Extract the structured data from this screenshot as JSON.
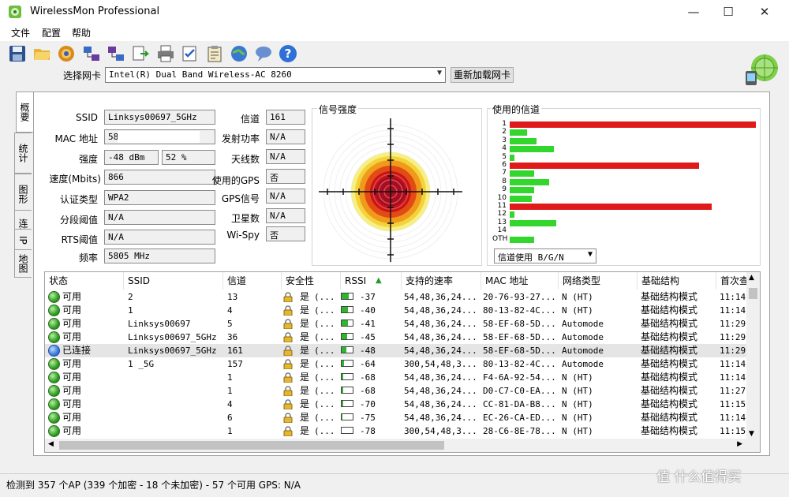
{
  "window": {
    "title": "WirelessMon Professional",
    "minimize": "—",
    "maximize": "☐",
    "close": "✕"
  },
  "menu": [
    "文件",
    "配置",
    "帮助"
  ],
  "toolbar_icons": [
    "save-icon",
    "open-folder-icon",
    "record-icon",
    "network-icon",
    "network-config-icon",
    "export-icon",
    "print-icon",
    "checklist-icon",
    "clipboard-icon",
    "globe-icon",
    "speech-icon",
    "help-icon"
  ],
  "nic": {
    "label": "选择网卡",
    "value": "Intel(R) Dual Band Wireless-AC 8260",
    "reload": "重新加载网卡"
  },
  "side_tabs": [
    "概要",
    "统计",
    "图形",
    "连接",
    "IP",
    "地图"
  ],
  "summary": {
    "ssid_label": "SSID",
    "ssid": "Linksys00697_5GHz",
    "mac_label": "MAC 地址",
    "mac": "58",
    "strength_label": "强度",
    "strength_dbm": "-48 dBm",
    "strength_pct": "52 %",
    "speed_label": "速度(Mbits)",
    "speed": "866",
    "auth_label": "认证类型",
    "auth": "WPA2",
    "frag_label": "分段阈值",
    "frag": "N/A",
    "rts_label": "RTS阈值",
    "rts": "N/A",
    "freq_label": "频率",
    "freq": "5805 MHz",
    "channel_label": "信道",
    "channel": "161",
    "txpower_label": "发射功率",
    "txpower": "N/A",
    "antenna_label": "天线数",
    "antenna": "N/A",
    "gps_use_label": "使用的GPS",
    "gps_use": "否",
    "gps_signal_label": "GPS信号",
    "gps_signal": "N/A",
    "sat_label": "卫星数",
    "sat": "N/A",
    "wispy_label": "Wi-Spy",
    "wispy": "否"
  },
  "signal": {
    "title": "信号强度",
    "colors": [
      "#f6ef88",
      "#f3d23a",
      "#ef9a1c",
      "#e34b14",
      "#c81317",
      "#a30e25"
    ]
  },
  "channels": {
    "title": "使用的信道",
    "labels": [
      "1",
      "2",
      "3",
      "4",
      "5",
      "6",
      "7",
      "8",
      "9",
      "10",
      "11",
      "12",
      "13",
      "14",
      "OTH"
    ],
    "usage": [
      100,
      7,
      11,
      18,
      2,
      77,
      10,
      16,
      10,
      9,
      82,
      2,
      19,
      0,
      10
    ],
    "highlight": [
      0,
      5,
      10
    ],
    "colors": {
      "hi": "#e01a1a",
      "normal": "#33d62c"
    },
    "select": "信道使用 B/G/N"
  },
  "table": {
    "headers": [
      "状态",
      "SSID",
      "信道",
      "安全性",
      "RSSI",
      "支持的速率",
      "MAC 地址",
      "网络类型",
      "基础结构",
      "首次查"
    ],
    "sort_arrow": "▲",
    "rows": [
      {
        "status": "可用",
        "state": "green",
        "ssid": "2",
        "channel": "13",
        "sec_yes": "是",
        "sec": "(...",
        "rssi": "-37",
        "rssi_pct": 62,
        "rates": "54,48,36,24...",
        "mac": "20-76-93-27...",
        "type": "N (HT)",
        "infra": "基础结构模式",
        "first": "11:14:"
      },
      {
        "status": "可用",
        "state": "green",
        "ssid": "1",
        "channel": "4",
        "sec_yes": "是",
        "sec": "(...",
        "rssi": "-40",
        "rssi_pct": 58,
        "rates": "54,48,36,24...",
        "mac": "80-13-82-4C...",
        "type": "N (HT)",
        "infra": "基础结构模式",
        "first": "11:14:"
      },
      {
        "status": "可用",
        "state": "green",
        "ssid": "Linksys00697",
        "channel": "5",
        "sec_yes": "是",
        "sec": "(...",
        "rssi": "-41",
        "rssi_pct": 56,
        "rates": "54,48,36,24...",
        "mac": "58-EF-68-5D...",
        "type": "Automode",
        "infra": "基础结构模式",
        "first": "11:29:"
      },
      {
        "status": "可用",
        "state": "green",
        "ssid": "Linksys00697_5GHz",
        "channel": "36",
        "sec_yes": "是",
        "sec": "(...",
        "rssi": "-45",
        "rssi_pct": 50,
        "rates": "54,48,36,24...",
        "mac": "58-EF-68-5D...",
        "type": "Automode",
        "infra": "基础结构模式",
        "first": "11:29:"
      },
      {
        "status": "已连接",
        "state": "blue",
        "ssid": "Linksys00697_5GHz",
        "channel": "161",
        "sec_yes": "是",
        "sec": "(...",
        "rssi": "-48",
        "rssi_pct": 45,
        "rates": "54,48,36,24...",
        "mac": "58-EF-68-5D...",
        "type": "Automode",
        "infra": "基础结构模式",
        "first": "11:29:"
      },
      {
        "status": "可用",
        "state": "green",
        "ssid": "1         _5G",
        "channel": "157",
        "sec_yes": "是",
        "sec": "(...",
        "rssi": "-64",
        "rssi_pct": 22,
        "rates": "300,54,48,3...",
        "mac": "80-13-82-4C...",
        "type": "Automode",
        "infra": "基础结构模式",
        "first": "11:14:"
      },
      {
        "status": "可用",
        "state": "green",
        "ssid": "",
        "channel": "1",
        "sec_yes": "是",
        "sec": "(...",
        "rssi": "-68",
        "rssi_pct": 15,
        "rates": "54,48,36,24...",
        "mac": "F4-6A-92-54...",
        "type": "N (HT)",
        "infra": "基础结构模式",
        "first": "11:14:"
      },
      {
        "status": "可用",
        "state": "green",
        "ssid": "",
        "channel": "1",
        "sec_yes": "是",
        "sec": "(...",
        "rssi": "-68",
        "rssi_pct": 15,
        "rates": "54,48,36,24...",
        "mac": "D0-C7-C0-EA...",
        "type": "N (HT)",
        "infra": "基础结构模式",
        "first": "11:27:"
      },
      {
        "status": "可用",
        "state": "green",
        "ssid": "",
        "channel": "4",
        "sec_yes": "是",
        "sec": "(...",
        "rssi": "-70",
        "rssi_pct": 12,
        "rates": "54,48,36,24...",
        "mac": "CC-81-DA-B8...",
        "type": "N (HT)",
        "infra": "基础结构模式",
        "first": "11:15:"
      },
      {
        "status": "可用",
        "state": "green",
        "ssid": "",
        "channel": "6",
        "sec_yes": "是",
        "sec": "(...",
        "rssi": "-75",
        "rssi_pct": 5,
        "rates": "54,48,36,24...",
        "mac": "EC-26-CA-ED...",
        "type": "N (HT)",
        "infra": "基础结构模式",
        "first": "11:14:"
      },
      {
        "status": "可用",
        "state": "green",
        "ssid": "",
        "channel": "1",
        "sec_yes": "是",
        "sec": "(...",
        "rssi": "-78",
        "rssi_pct": 3,
        "rates": "300,54,48,3...",
        "mac": "28-C6-8E-78...",
        "type": "N (HT)",
        "infra": "基础结构模式",
        "first": "11:15:"
      }
    ]
  },
  "status_bar": "检测到 357 个AP (339 个加密 - 18 个未加密) - 57 个可用 GPS: N/A",
  "watermark": "值 什么值得买"
}
